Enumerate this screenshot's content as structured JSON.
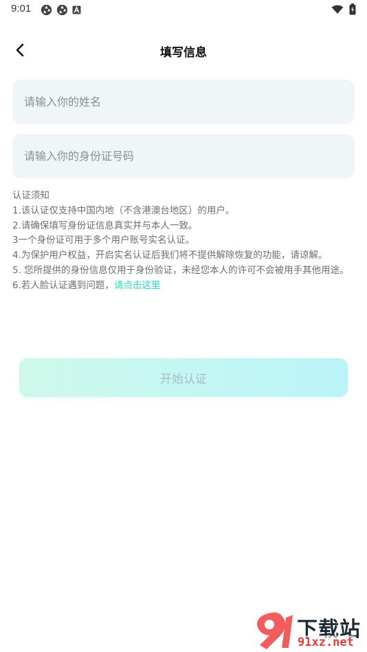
{
  "status_bar": {
    "time": "9:01",
    "left_icons": [
      "aperture-icon",
      "aperture-icon",
      "a-letter-icon"
    ],
    "right_icons": [
      "wifi-icon",
      "battery-icon"
    ]
  },
  "header": {
    "back_icon": "chevron-left-icon",
    "title": "填写信息"
  },
  "form": {
    "name_placeholder": "请输入你的姓名",
    "name_value": "",
    "id_placeholder": "请输入你的身份证号码",
    "id_value": ""
  },
  "notice": {
    "heading": "认证须知",
    "items": [
      "1.该认证仅支持中国内地（不含港澳台地区）的用户。",
      "2.请确保填写身份证信息真实并与本人一致。",
      "3一个身份证可用于多个用户账号实名认证。",
      "4.为保护用户权益，开启实名认证后我们将不提供解除恢复的功能，请谅解。",
      "5. 您所提供的身份信息仅用于身份验证，未经您本人的许可不会被用手其他用途。"
    ],
    "item6_prefix": "6.若人脸认证遇到问题，",
    "item6_link": "请点击这里",
    "link_color": "#2ad3c5"
  },
  "start_button": {
    "label": "开始认证"
  },
  "watermark": {
    "text": "下载站",
    "url": "91xz.net"
  }
}
